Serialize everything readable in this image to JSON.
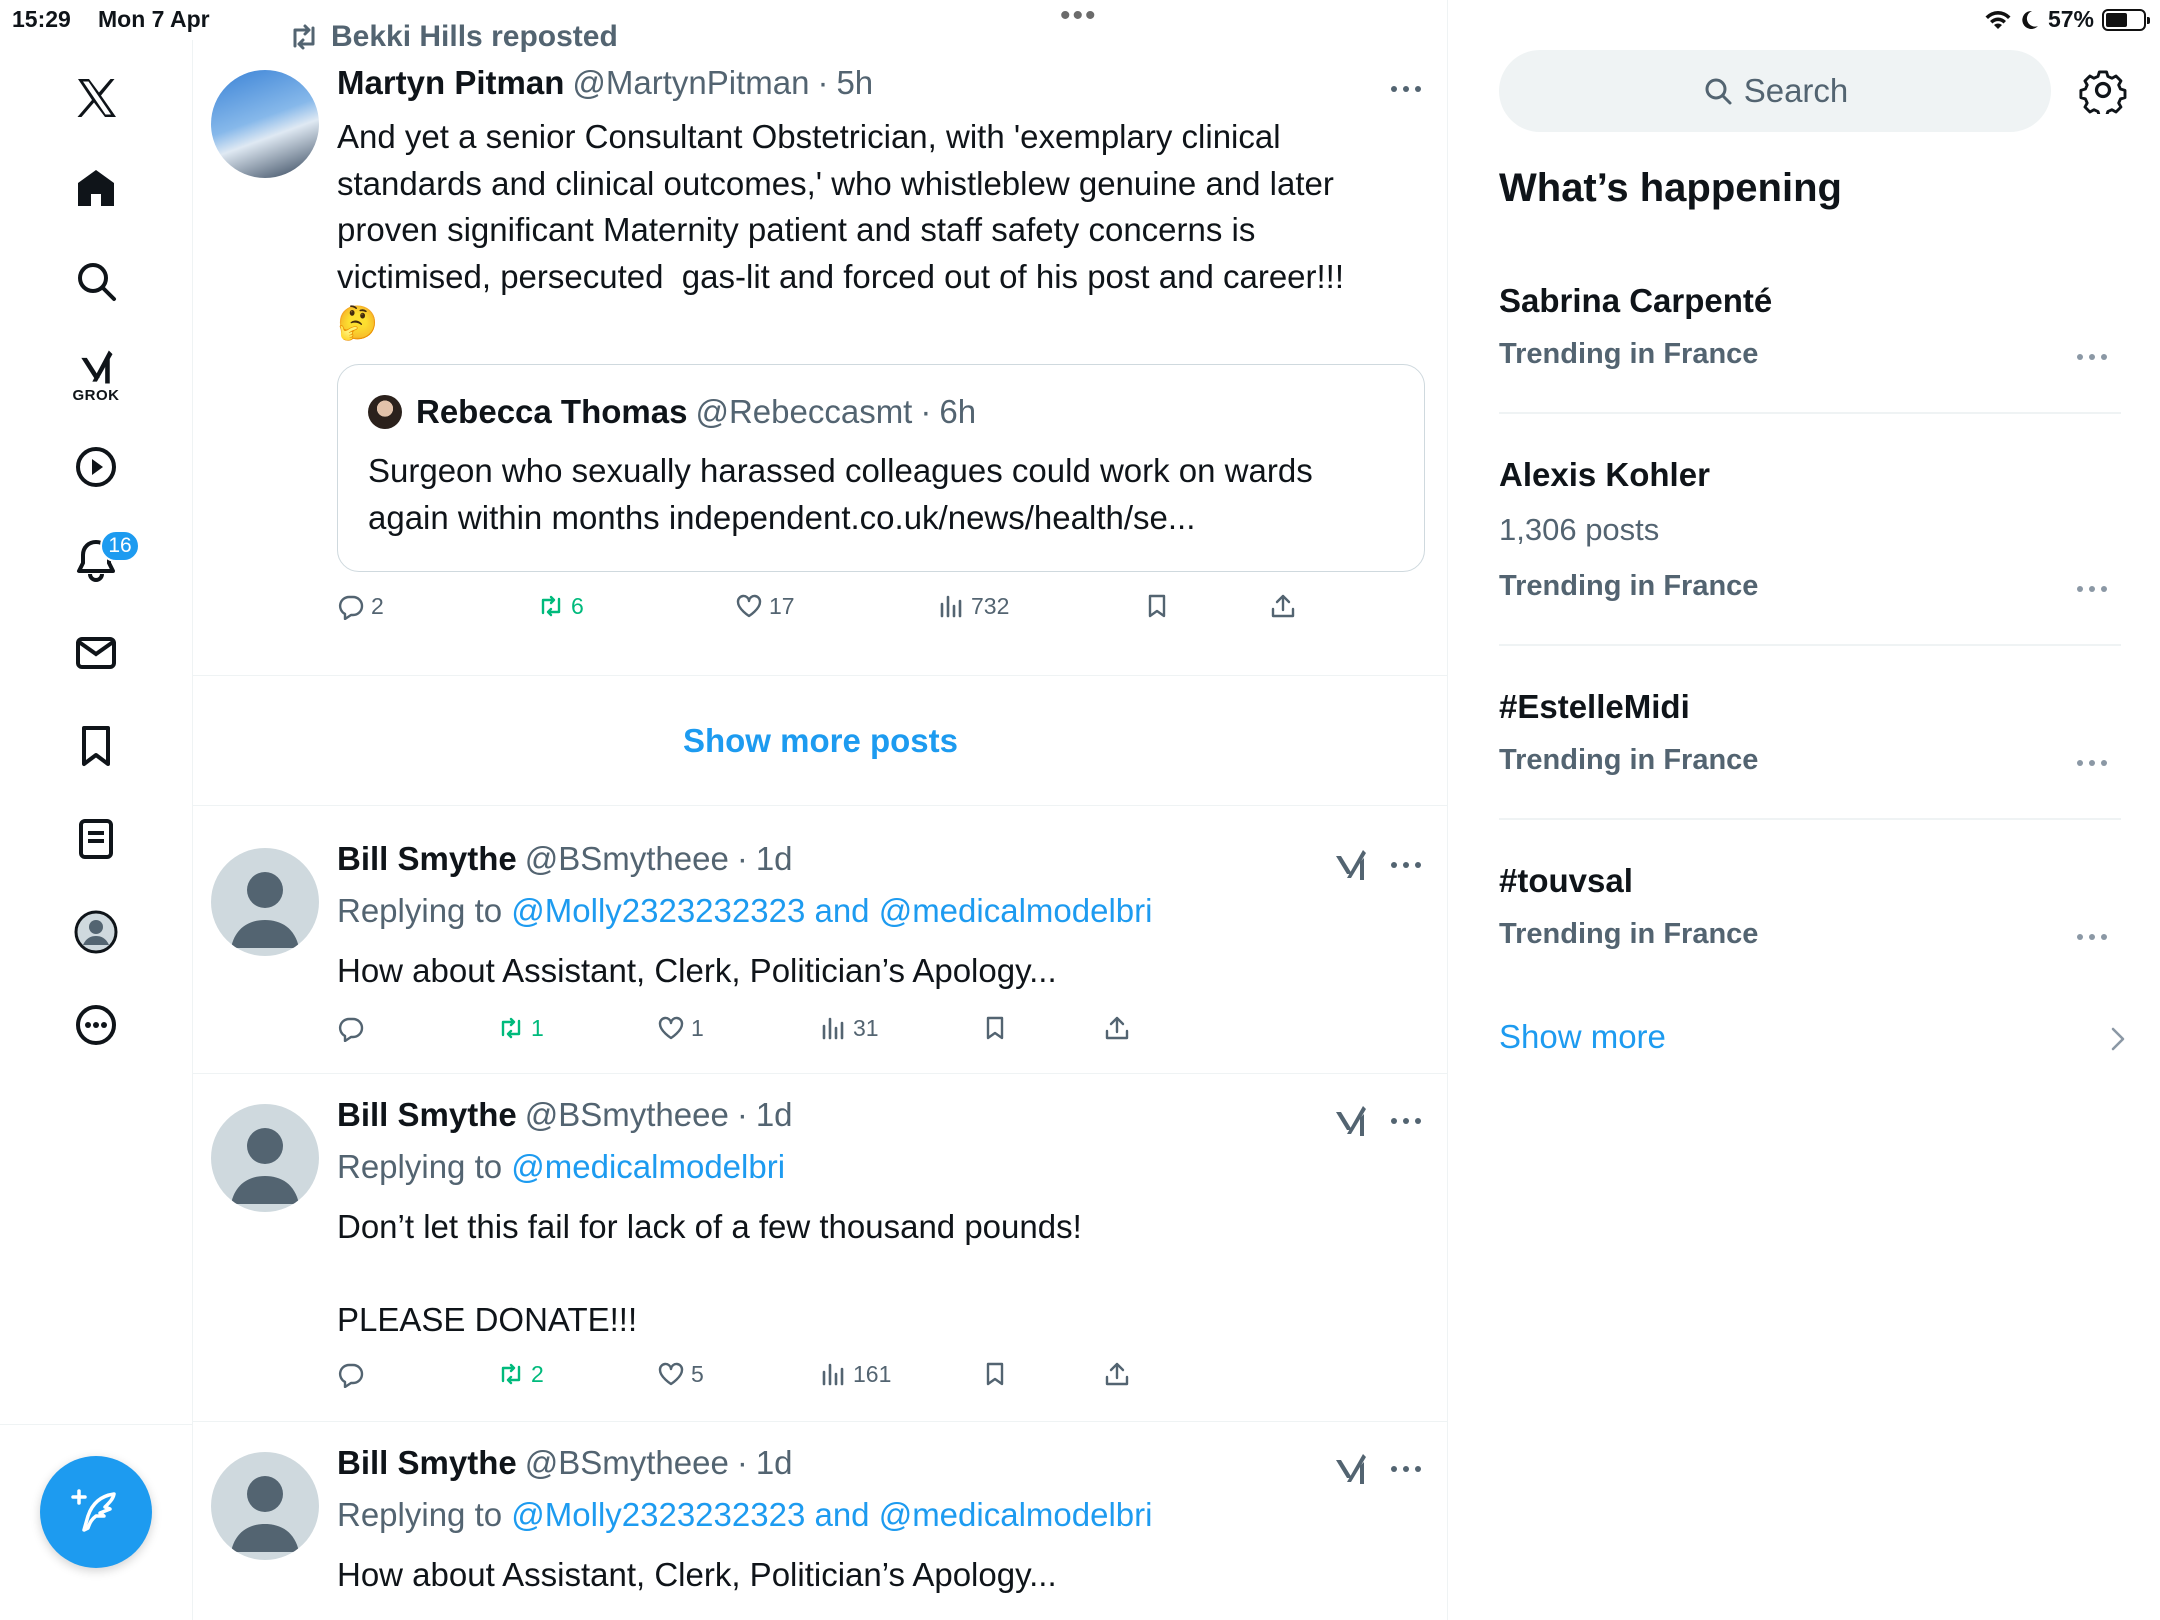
{
  "status_bar": {
    "time": "15:29",
    "date": "Mon 7 Apr",
    "battery": "57%",
    "battery_level": 0.57
  },
  "left_rail": {
    "grok_label": "GROK",
    "notifications_badge": "16",
    "icons": [
      "x-logo-icon",
      "home-icon",
      "search-icon",
      "grok-icon",
      "video-icon",
      "notifications-icon",
      "messages-icon",
      "bookmarks-icon",
      "lists-icon",
      "profile-icon",
      "more-icon",
      "compose-icon"
    ]
  },
  "feed": {
    "repost": {
      "reposted_by": "Bekki Hills reposted",
      "name": "Martyn Pitman",
      "handle": "@MartynPitman",
      "dot": "·",
      "time": "5h",
      "text": "And yet a senior Consultant Obstetrician, with 'exemplary clinical standards and clinical outcomes,' who whistleblew genuine and later proven significant Maternity patient and staff safety concerns is victimised, persecuted  gas-lit and forced out of his post and career!!!",
      "emoji": "🤔",
      "quote": {
        "name": "Rebecca Thomas",
        "handle": "@Rebeccasmt",
        "dot": "·",
        "time": "6h",
        "text": "Surgeon who sexually harassed colleagues could work on wards again within months independent.co.uk/news/health/se..."
      },
      "stats": {
        "replies": "2",
        "reposts": "6",
        "likes": "17",
        "views": "732"
      }
    },
    "show_more_posts": "Show more posts",
    "replies": [
      {
        "name": "Bill Smythe",
        "handle": "@BSmytheee",
        "dot": "·",
        "time": "1d",
        "replying_prefix": "Replying to ",
        "replying_to": "@Molly2323232323 and @medicalmodelbri",
        "text": "How about Assistant, Clerk, Politician’s Apology...",
        "stats": {
          "replies": "",
          "reposts": "1",
          "likes": "1",
          "views": "31"
        }
      },
      {
        "name": "Bill Smythe",
        "handle": "@BSmytheee",
        "dot": "·",
        "time": "1d",
        "replying_prefix": "Replying to ",
        "replying_to": "@medicalmodelbri",
        "text": "Don’t let this fail for lack of a few thousand pounds!\n\nPLEASE DONATE!!!",
        "stats": {
          "replies": "",
          "reposts": "2",
          "likes": "5",
          "views": "161"
        }
      },
      {
        "name": "Bill Smythe",
        "handle": "@BSmytheee",
        "dot": "·",
        "time": "1d",
        "replying_prefix": "Replying to ",
        "replying_to": "@Molly2323232323 and @medicalmodelbri",
        "text": "How about Assistant, Clerk, Politician’s Apology..."
      }
    ]
  },
  "sidebar": {
    "search_placeholder": "Search",
    "section_title": "What’s happening",
    "trends": [
      {
        "name": "Sabrina Carpenté",
        "count": "",
        "context": "Trending in France"
      },
      {
        "name": "Alexis Kohler",
        "count": "1,306 posts",
        "context": "Trending in France"
      },
      {
        "name": "#EstelleMidi",
        "count": "",
        "context": "Trending in France"
      },
      {
        "name": "#touvsal",
        "count": "",
        "context": "Trending in France"
      }
    ],
    "show_more": "Show more"
  },
  "colors": {
    "accent": "#1d9bf0",
    "repost_green": "#00ba7c",
    "secondary_text": "#536471",
    "border": "#eff3f4"
  }
}
